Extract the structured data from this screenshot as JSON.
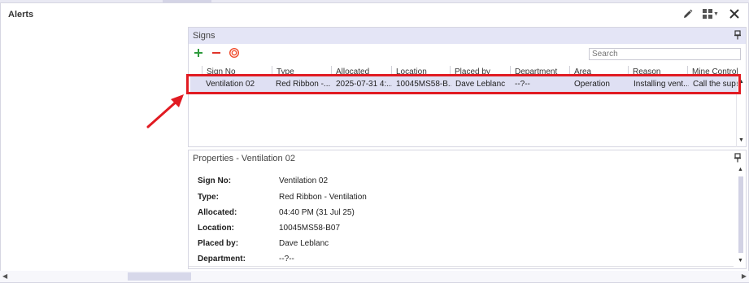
{
  "window": {
    "title": "Alerts",
    "icons": [
      "pencil-icon",
      "grid-layout-icon",
      "close-icon"
    ]
  },
  "signs_panel": {
    "title": "Signs",
    "toolbar": {
      "add_icon": "plus-icon",
      "remove_icon": "minus-icon",
      "stop_icon": "stop-sign-icon",
      "search_placeholder": "Search"
    },
    "columns": [
      "Sign No",
      "Type",
      "Allocated",
      "Location",
      "Placed by",
      "Department",
      "Area",
      "Reason",
      "Mine Control..."
    ],
    "rows": [
      {
        "sign_no": "Ventilation 02",
        "type": "Red Ribbon -...",
        "allocated": "2025-07-31 4:...",
        "location": "10045MS58-B...",
        "placed_by": "Dave Leblanc",
        "department": "--?--",
        "area": "Operation",
        "reason": "Installing vent...",
        "mine_control": "Call the super..."
      }
    ]
  },
  "properties_panel": {
    "title": "Properties - Ventilation 02",
    "fields": [
      {
        "key": "Sign No:",
        "value": "Ventilation 02"
      },
      {
        "key": "Type:",
        "value": "Red Ribbon - Ventilation"
      },
      {
        "key": "Allocated:",
        "value": "04:40 PM (31 Jul 25)"
      },
      {
        "key": "Location:",
        "value": "10045MS58-B07"
      },
      {
        "key": "Placed by:",
        "value": "Dave Leblanc"
      },
      {
        "key": "Department:",
        "value": "--?--"
      }
    ]
  },
  "colors": {
    "highlight": "#e11b22",
    "panel_header": "#e4e5f6",
    "selected_row": "#dfe0f3",
    "add": "#2e9b3c",
    "remove": "#e0342a"
  }
}
